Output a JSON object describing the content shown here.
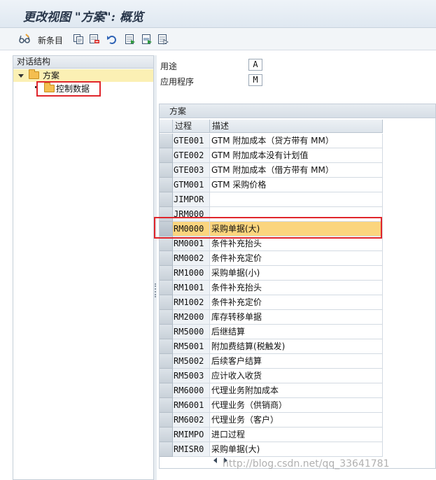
{
  "window": {
    "title": "更改视图 \"方案\": 概览"
  },
  "toolbar": {
    "new_entries_label": "新条目",
    "icons": [
      "glasses-icon",
      "copy-icon",
      "delete-icon",
      "undo-icon",
      "select-all-icon",
      "select-block-icon",
      "deselect-all-icon"
    ]
  },
  "tree": {
    "header": "对话结构",
    "root": {
      "label": "方案",
      "icon": "folder-open-icon"
    },
    "child": {
      "label": "控制数据",
      "icon": "folder-icon"
    }
  },
  "fields": {
    "usage_label": "用途",
    "usage_value": "A",
    "application_label": "应用程序",
    "application_value": "M"
  },
  "table": {
    "title": "方案",
    "columns": [
      "过程",
      "描述"
    ],
    "rows": [
      {
        "code": "GTE001",
        "desc": "GTM 附加成本（贷方带有 MM）"
      },
      {
        "code": "GTE002",
        "desc": "GTM 附加成本没有计划值"
      },
      {
        "code": "GTE003",
        "desc": "GTM 附加成本（借方带有 MM）"
      },
      {
        "code": "GTM001",
        "desc": "GTM 采购价格"
      },
      {
        "code": "JIMPOR",
        "desc": ""
      },
      {
        "code": "JRM000",
        "desc": ""
      },
      {
        "code": "RM0000",
        "desc": "采购单据(大)"
      },
      {
        "code": "RM0001",
        "desc": "条件补充抬头"
      },
      {
        "code": "RM0002",
        "desc": "条件补充定价"
      },
      {
        "code": "RM1000",
        "desc": "采购单据(小)"
      },
      {
        "code": "RM1001",
        "desc": "条件补充抬头"
      },
      {
        "code": "RM1002",
        "desc": "条件补充定价"
      },
      {
        "code": "RM2000",
        "desc": "库存转移单据"
      },
      {
        "code": "RM5000",
        "desc": "后继结算"
      },
      {
        "code": "RM5001",
        "desc": "附加费结算(税触发)"
      },
      {
        "code": "RM5002",
        "desc": "后续客户结算"
      },
      {
        "code": "RM5003",
        "desc": "应计收入收货"
      },
      {
        "code": "RM6000",
        "desc": "代理业务附加成本"
      },
      {
        "code": "RM6001",
        "desc": "代理业务（供销商）"
      },
      {
        "code": "RM6002",
        "desc": "代理业务（客户）"
      },
      {
        "code": "RMIMPO",
        "desc": "进口过程"
      },
      {
        "code": "RMISR0",
        "desc": "采购单据(大)"
      }
    ],
    "selected_row_index": 6
  },
  "watermark": "http://blog.csdn.net/qq_33641781",
  "colors": {
    "selection": "#fbd57e",
    "tree_selection": "#fbf0b4",
    "annotation_red": "#e0262c"
  }
}
